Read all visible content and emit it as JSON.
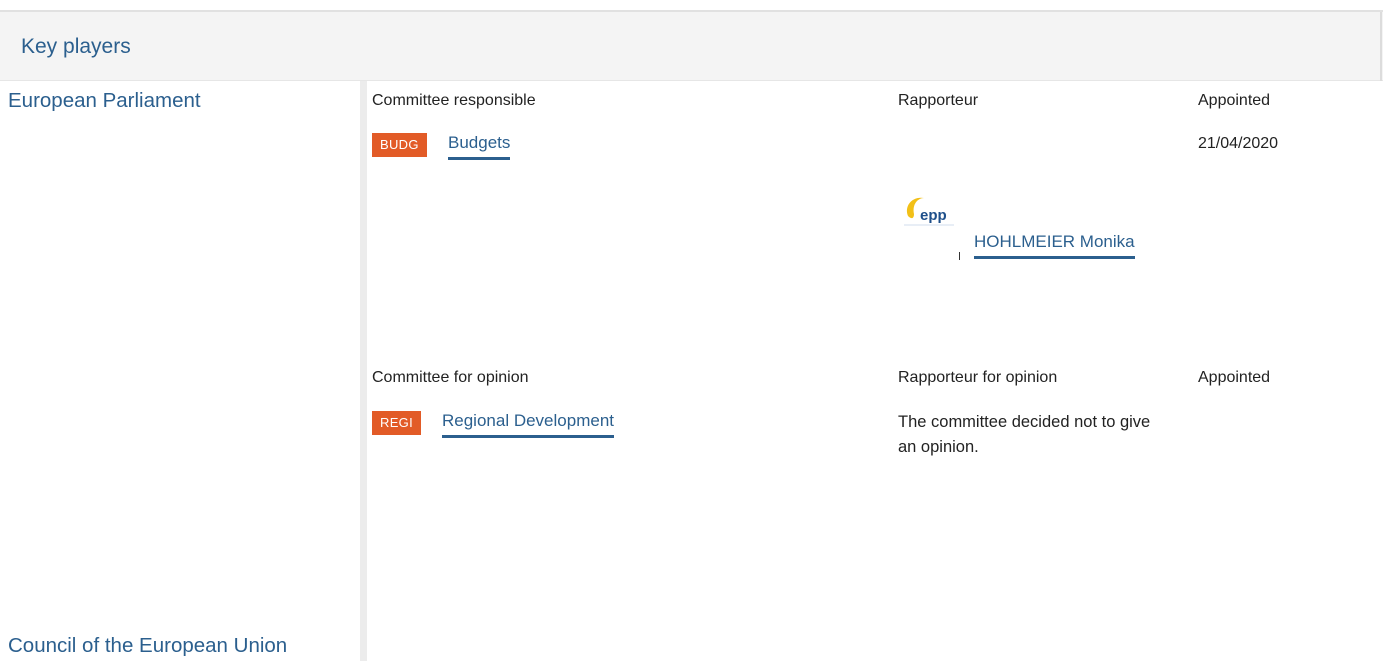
{
  "section": {
    "title": "Key players"
  },
  "institutions": {
    "parliament": "European Parliament",
    "council": "Council of the European Union"
  },
  "responsible": {
    "headers": {
      "committee": "Committee responsible",
      "rapporteur": "Rapporteur",
      "appointed": "Appointed"
    },
    "committee": {
      "code": "BUDG",
      "name": "Budgets"
    },
    "appointed": "21/04/2020",
    "rapporteur": {
      "group_logo": "epp-logo",
      "name": "HOHLMEIER Monika"
    }
  },
  "opinion": {
    "headers": {
      "committee": "Committee for opinion",
      "rapporteur": "Rapporteur for opinion",
      "appointed": "Appointed"
    },
    "committee": {
      "code": "REGI",
      "name": "Regional Development"
    },
    "rapporteur_text": "The committee decided not to give an opinion."
  },
  "colors": {
    "link": "#2b5f8e",
    "badge": "#e25b27",
    "header_bg": "#f4f4f4"
  }
}
